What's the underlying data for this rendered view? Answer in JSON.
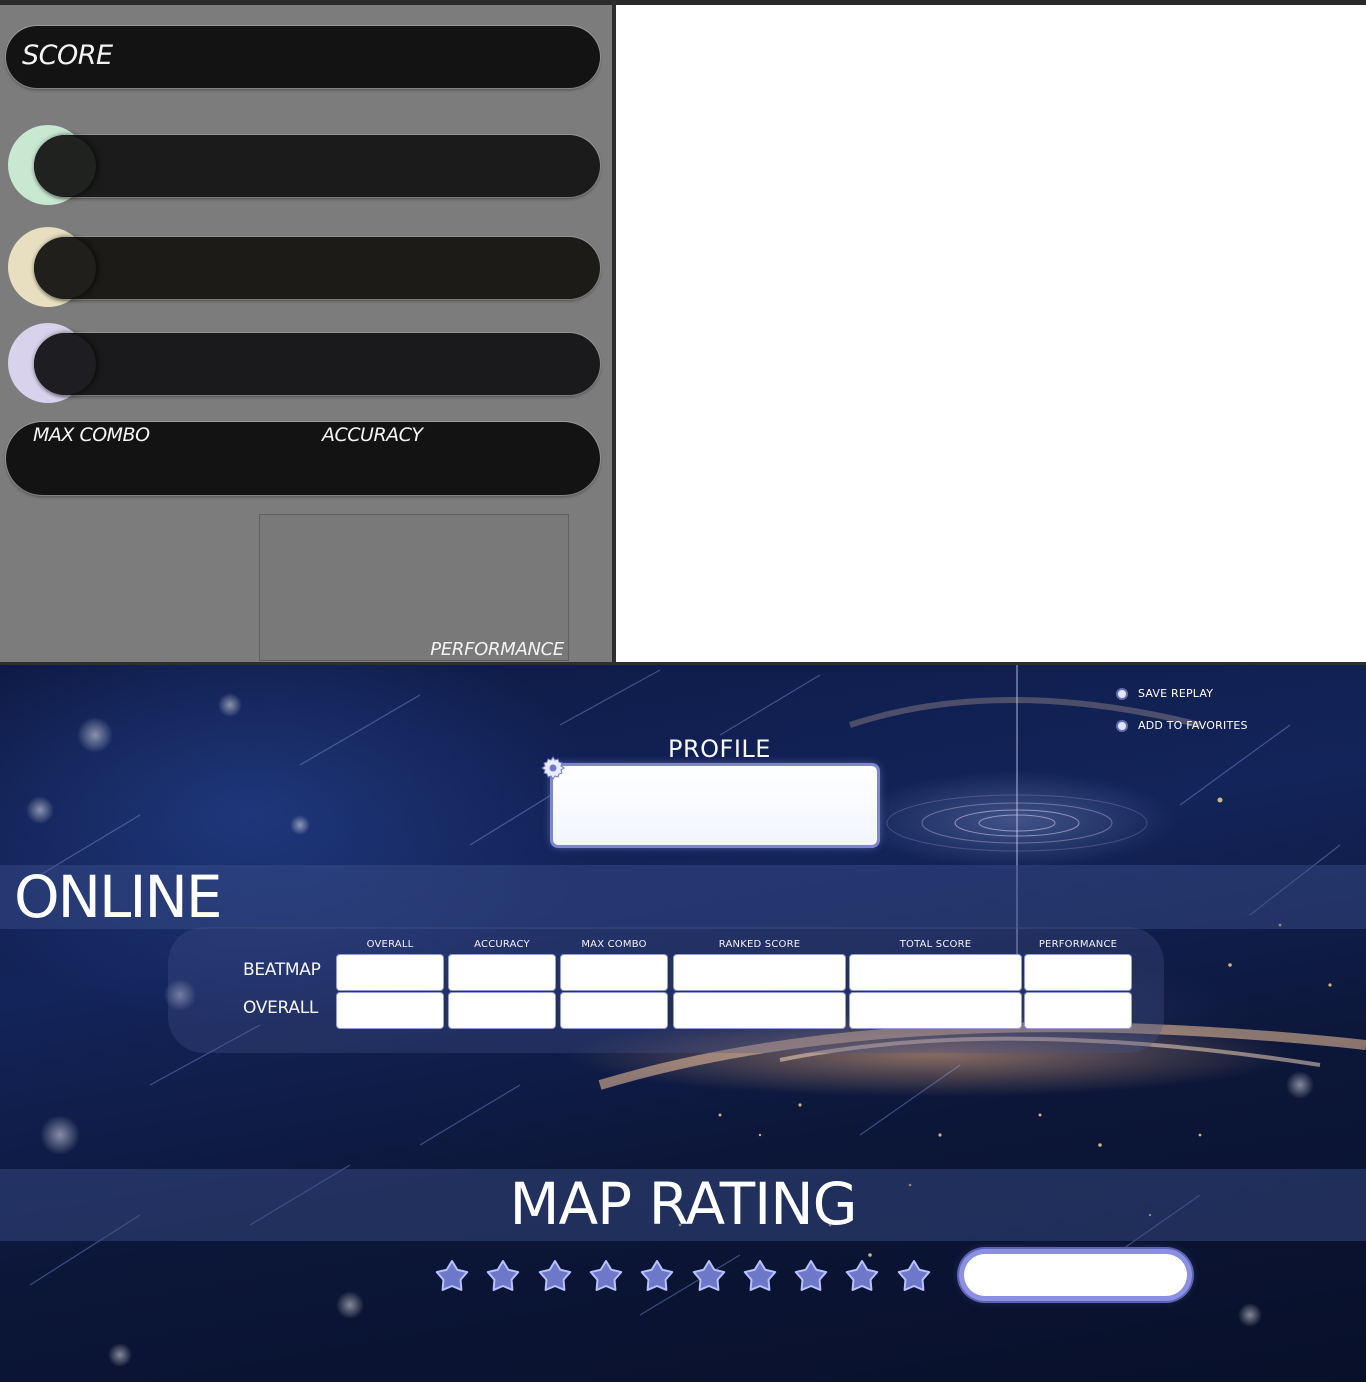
{
  "result_panel": {
    "score_label": "SCORE",
    "judgement_colors": [
      "#c8e8d2",
      "#e7dfc0",
      "#d8d2ec"
    ],
    "max_combo_label": "MAX COMBO",
    "accuracy_label": "ACCURACY",
    "performance_label": "PERFORMANCE"
  },
  "menu": {
    "save_replay": "SAVE REPLAY",
    "add_to_favorites": "ADD TO FAVORITES"
  },
  "profile": {
    "label": "PROFILE"
  },
  "online": {
    "title": "ONLINE",
    "columns": [
      "OVERALL",
      "ACCURACY",
      "MAX COMBO",
      "RANKED SCORE",
      "TOTAL SCORE",
      "PERFORMANCE"
    ],
    "rows": [
      "BEATMAP",
      "OVERALL"
    ]
  },
  "map_rating": {
    "title": "MAP RATING",
    "star_count": 10,
    "star_color": "#6d78c8"
  },
  "colors": {
    "panel_bg": "#7c7c7c",
    "pill_bg": "#131313",
    "accent": "#8c90e2"
  }
}
